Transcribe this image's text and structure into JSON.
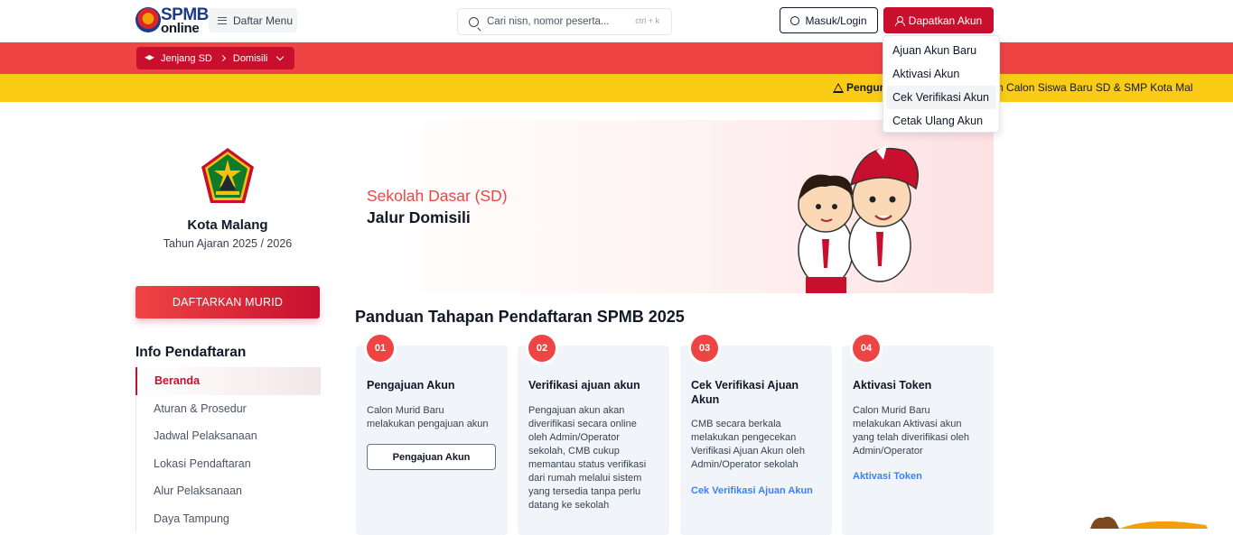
{
  "header": {
    "logo_text_1": "SPMB",
    "logo_text_2": "online",
    "menu_label": "Daftar Menu",
    "search_placeholder": "Cari nisn, nomor peserta...",
    "search_shortcut": "ctrl + k",
    "login_label": "Masuk/Login",
    "get_account_label": "Dapatkan Akun"
  },
  "account_menu": {
    "items": [
      {
        "label": "Ajuan Akun Baru",
        "active": false
      },
      {
        "label": "Aktivasi Akun",
        "active": false
      },
      {
        "label": "Cek Verifikasi Akun",
        "active": true
      },
      {
        "label": "Cetak Ulang Akun",
        "active": false
      }
    ]
  },
  "breadcrumb": {
    "level": "Jenjang SD",
    "path": "Domisili"
  },
  "announcement": {
    "bold": "Pengumu",
    "text": "la, dan Calon Siswa Baru SD & SMP Kota Mal"
  },
  "sidebar": {
    "city": "Kota Malang",
    "academic_year": "Tahun Ajaran 2025 / 2026",
    "register_button": "DAFTARKAN MURID",
    "info_title": "Info Pendaftaran",
    "nav": [
      {
        "label": "Beranda",
        "active": true
      },
      {
        "label": "Aturan & Prosedur",
        "active": false
      },
      {
        "label": "Jadwal Pelaksanaan",
        "active": false
      },
      {
        "label": "Lokasi Pendaftaran",
        "active": false
      },
      {
        "label": "Alur Pelaksanaan",
        "active": false
      },
      {
        "label": "Daya Tampung",
        "active": false
      }
    ]
  },
  "hero": {
    "subtitle": "Sekolah Dasar (SD)",
    "title": "Jalur Domisili"
  },
  "guide": {
    "title": "Panduan Tahapan Pendaftaran SPMB 2025",
    "steps": [
      {
        "number": "01",
        "title": "Pengajuan Akun",
        "text": "Calon Murid Baru melakukan pengajuan akun",
        "button": "Pengajuan Akun"
      },
      {
        "number": "02",
        "title": "Verifikasi ajuan akun",
        "text": "Pengajuan akun akan diverifikasi secara online oleh Admin/Operator sekolah, CMB cukup memantau status verifikasi dari rumah melalui sistem yang tersedia tanpa perlu datang ke sekolah"
      },
      {
        "number": "03",
        "title": "Cek Verifikasi Ajuan Akun",
        "text": "CMB secara berkala melakukan pengecekan Verifikasi Ajuan Akun oleh Admin/Operator sekolah",
        "link": "Cek Verifikasi Ajuan Akun"
      },
      {
        "number": "04",
        "title": "Aktivasi Token",
        "text": "Calon Murid Baru melakukan Aktivasi akun yang telah diverifikasi oleh Admin/Operator",
        "link": "Aktivasi Token"
      }
    ]
  },
  "colors": {
    "brand_red": "#c8102e",
    "bar_red": "#ef4444",
    "bar_yellow": "#facc15",
    "link_blue": "#3b82f6"
  }
}
